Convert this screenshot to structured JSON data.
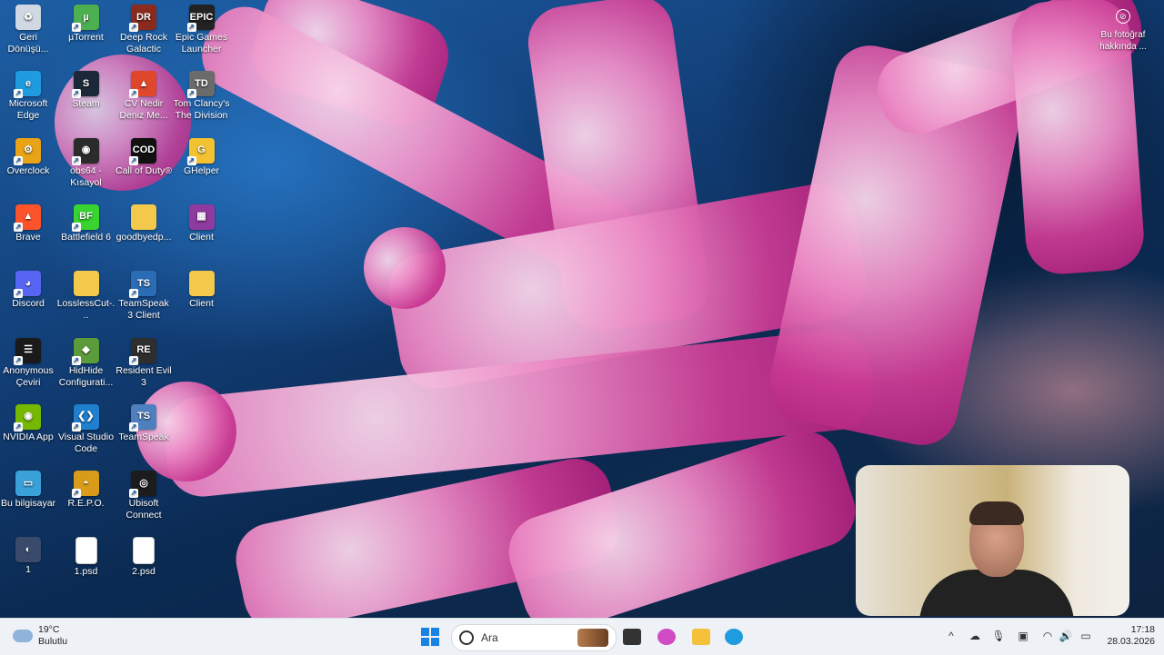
{
  "desktop": {
    "icons": [
      {
        "label": "Geri Dönüşü...",
        "icon": "recycle-bin-icon",
        "color": "#cfd8e3",
        "glyph": "♻"
      },
      {
        "label": "µTorrent",
        "icon": "utorrent-icon",
        "color": "#4caf50",
        "glyph": "µ"
      },
      {
        "label": "Deep Rock Galactic",
        "icon": "deep-rock-galactic-icon",
        "color": "#8b2b1e",
        "glyph": "DR"
      },
      {
        "label": "Epic Games Launcher",
        "icon": "epic-games-icon",
        "color": "#222222",
        "glyph": "EPIC"
      },
      {
        "label": "Microsoft Edge",
        "icon": "edge-icon",
        "color": "#1f9be0",
        "glyph": "e"
      },
      {
        "label": "Steam",
        "icon": "steam-icon",
        "color": "#1b2838",
        "glyph": "S"
      },
      {
        "label": "CV Nedir Deniz Me...",
        "icon": "brave-pdf-icon",
        "color": "#e0462b",
        "glyph": "▲"
      },
      {
        "label": "Tom Clancy's The Division",
        "icon": "division-icon",
        "color": "#6b6b6b",
        "glyph": "TD"
      },
      {
        "label": "Overclock",
        "icon": "overclock-icon",
        "color": "#e8a317",
        "glyph": "⚙"
      },
      {
        "label": "obs64 - Kısayol",
        "icon": "obs-icon",
        "color": "#2b2b2b",
        "glyph": "◉"
      },
      {
        "label": "Call of Duty®",
        "icon": "call-of-duty-icon",
        "color": "#111111",
        "glyph": "COD"
      },
      {
        "label": "GHelper",
        "icon": "ghelper-icon",
        "color": "#f2c230",
        "glyph": "G"
      },
      {
        "label": "Brave",
        "icon": "brave-icon",
        "color": "#fb542b",
        "glyph": "▲"
      },
      {
        "label": "Battlefield 6",
        "icon": "battlefield-icon",
        "color": "#38d430",
        "glyph": "BF"
      },
      {
        "label": "goodbyedp...",
        "icon": "folder-icon",
        "color": "#f3c94b",
        "glyph": ""
      },
      {
        "label": "Client",
        "icon": "winrar-icon",
        "color": "#8e3a9e",
        "glyph": "▦"
      },
      {
        "label": "Discord",
        "icon": "discord-icon",
        "color": "#5865f2",
        "glyph": "◕"
      },
      {
        "label": "LosslessCut-...",
        "icon": "folder-icon",
        "color": "#f3c94b",
        "glyph": ""
      },
      {
        "label": "TeamSpeak 3 Client",
        "icon": "teamspeak-icon",
        "color": "#2a6db5",
        "glyph": "TS"
      },
      {
        "label": "Client",
        "icon": "folder-icon",
        "color": "#f3c94b",
        "glyph": ""
      },
      {
        "label": "Anonymous Çeviri",
        "icon": "anonymous-icon",
        "color": "#1a1a1a",
        "glyph": "☰"
      },
      {
        "label": "HidHide Configurati...",
        "icon": "hidhide-icon",
        "color": "#5c9b3a",
        "glyph": "◆"
      },
      {
        "label": "Resident Evil 3",
        "icon": "resident-evil-icon",
        "color": "#2e2e2e",
        "glyph": "RE"
      },
      {
        "label": "NVIDIA App",
        "icon": "nvidia-icon",
        "color": "#76b900",
        "glyph": "◉"
      },
      {
        "label": "Visual Studio Code",
        "icon": "vscode-icon",
        "color": "#1f80d0",
        "glyph": "❮❯"
      },
      {
        "label": "TeamSpeak",
        "icon": "teamspeak-icon",
        "color": "#4f7fbf",
        "glyph": "TS"
      },
      {
        "label": "Bu bilgisayar",
        "icon": "this-pc-icon",
        "color": "#3aa0d8",
        "glyph": "▭"
      },
      {
        "label": "R.E.P.O.",
        "icon": "repo-icon",
        "color": "#d89b1a",
        "glyph": "◓"
      },
      {
        "label": "Ubisoft Connect",
        "icon": "ubisoft-icon",
        "color": "#1c1c1c",
        "glyph": "◎"
      },
      {
        "label": "1",
        "icon": "image-file-icon",
        "color": "#394a6b",
        "glyph": "◐"
      },
      {
        "label": "1.psd",
        "icon": "psd-file-icon",
        "color": "#ffffff",
        "glyph": ""
      },
      {
        "label": "2.psd",
        "icon": "psd-file-icon",
        "color": "#ffffff",
        "glyph": ""
      }
    ]
  },
  "photo_info": {
    "label": "Bu fotoğraf hakkında ..."
  },
  "taskbar": {
    "weather": {
      "temp": "19°C",
      "condition": "Bulutlu"
    },
    "search": {
      "placeholder": "Ara"
    },
    "clock": {
      "time": "17:18",
      "date": "28.03.2026"
    },
    "apps": [
      {
        "name": "task-view-icon",
        "color": "#333333"
      },
      {
        "name": "microsoft-365-icon",
        "color": "#d04cc4"
      },
      {
        "name": "file-explorer-icon",
        "color": "#f3c13a"
      },
      {
        "name": "edge-icon",
        "color": "#1f9be0"
      }
    ],
    "tray": [
      {
        "name": "chevron-up-icon",
        "glyph": "^"
      },
      {
        "name": "onedrive-icon",
        "glyph": "☁"
      },
      {
        "name": "microphone-icon",
        "glyph": "🎙"
      },
      {
        "name": "security-icon",
        "glyph": "▣"
      },
      {
        "name": "wifi-icon",
        "glyph": "◠"
      },
      {
        "name": "volume-icon",
        "glyph": "🔊"
      },
      {
        "name": "battery-icon",
        "glyph": "▭"
      }
    ]
  }
}
